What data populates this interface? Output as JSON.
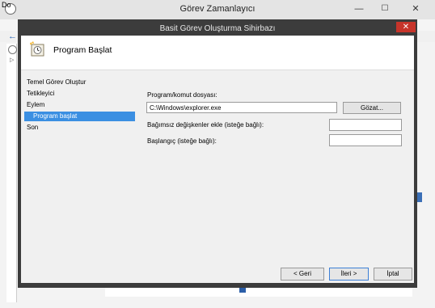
{
  "background_app": {
    "title": "Görev Zamanlayıcı",
    "menu_fragment": "Do",
    "minimize_glyph": "—",
    "maximize_glyph": "☐",
    "close_glyph": "✕",
    "back_glyph": "←",
    "tree_arrow_glyph": "▷"
  },
  "wizard": {
    "title": "Basit Görev Oluşturma Sihirbazı",
    "close_glyph": "✕",
    "header_title": "Program Başlat",
    "header_icon": "task-clock-icon",
    "steps": [
      {
        "label": "Temel Görev Oluştur",
        "selected": false
      },
      {
        "label": "Tetikleyici",
        "selected": false
      },
      {
        "label": "Eylem",
        "selected": false
      },
      {
        "label": "Program başlat",
        "selected": true
      },
      {
        "label": "Son",
        "selected": false
      }
    ],
    "form": {
      "program_label": "Program/komut dosyası:",
      "program_value": "C:\\Windows\\explorer.exe",
      "browse_label": "Gözat...",
      "args_label": "Bağımsız değişkenler ekle (isteğe bağlı):",
      "args_value": "",
      "start_label": "Başlangıç (isteğe bağlı):",
      "start_value": ""
    },
    "buttons": {
      "back": "< Geri",
      "next": "İleri >",
      "cancel": "İptal"
    },
    "colors": {
      "selection": "#3b8fe2",
      "frame": "#3c3c3c",
      "close": "#c7342a"
    }
  }
}
